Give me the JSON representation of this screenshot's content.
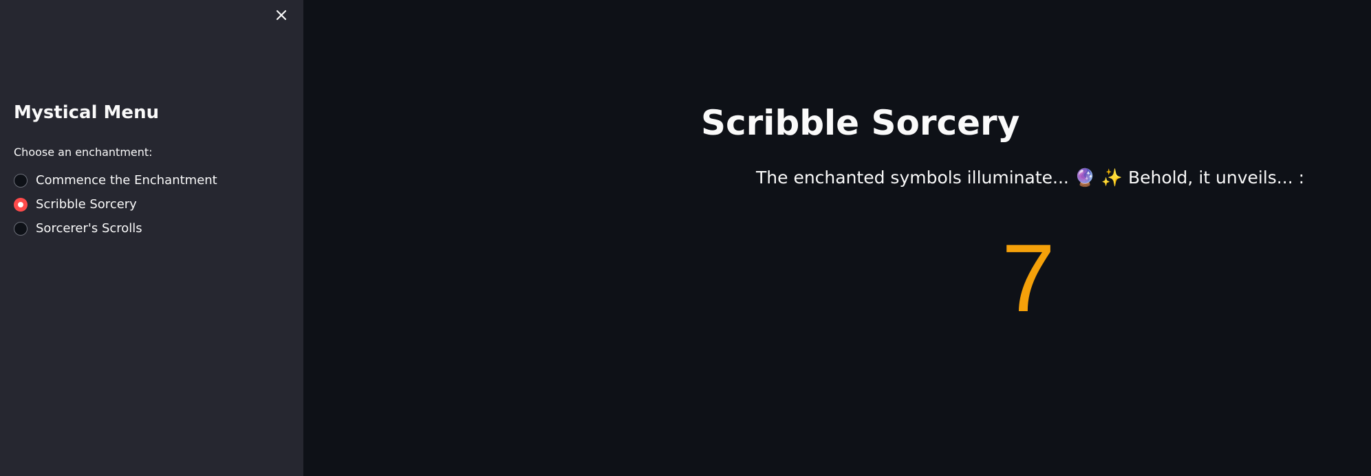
{
  "sidebar": {
    "title": "Mystical Menu",
    "radio_label": "Choose an enchantment:",
    "options": [
      {
        "label": "Commence the Enchantment",
        "selected": false
      },
      {
        "label": "Scribble Sorcery",
        "selected": true
      },
      {
        "label": "Sorcerer's Scrolls",
        "selected": false
      }
    ],
    "close_icon": "close-icon"
  },
  "main": {
    "title": "Scribble Sorcery",
    "subtitle": "The enchanted symbols illuminate... 🔮 ✨ Behold, it unveils... :",
    "result": "7"
  },
  "colors": {
    "background": "#0e1117",
    "sidebar_background": "#262730",
    "accent": "#ff4b4b",
    "result": "#f5a10a",
    "text": "#fafafa"
  }
}
